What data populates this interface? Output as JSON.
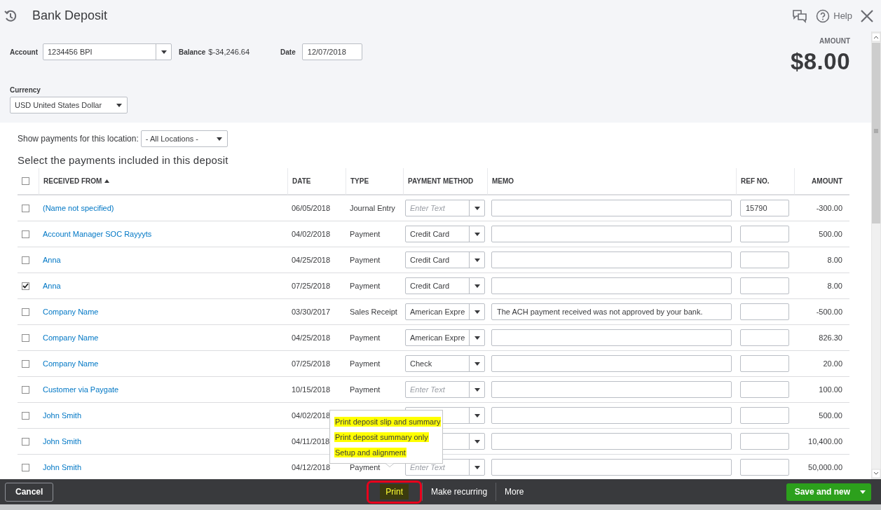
{
  "window": {
    "title": "Bank Deposit",
    "help": "Help"
  },
  "form": {
    "account": {
      "label": "Account",
      "value": "1234456 BPI"
    },
    "balance": {
      "label": "Balance",
      "value": "$-34,246.64"
    },
    "date": {
      "label": "Date",
      "value": "12/07/2018"
    },
    "currency": {
      "label": "Currency",
      "value": "USD United States Dollar"
    },
    "amount": {
      "label": "AMOUNT",
      "value": "$8.00"
    }
  },
  "location": {
    "label": "Show payments for this location:",
    "value": "- All Locations -"
  },
  "section_title": "Select the payments included in this deposit",
  "table": {
    "select_all": {
      "checked": false
    },
    "columns": [
      "RECEIVED FROM",
      "DATE",
      "TYPE",
      "PAYMENT METHOD",
      "MEMO",
      "REF NO.",
      "AMOUNT"
    ],
    "rows": [
      {
        "checked": false,
        "received_from": "(Name not specified)",
        "date": "06/05/2018",
        "type": "Journal Entry",
        "payment_placeholder": "Enter Text",
        "ref_no": "15790",
        "amount": "-300.00"
      },
      {
        "checked": false,
        "received_from": "Account Manager SOC Rayyyts",
        "date": "04/02/2018",
        "type": "Payment",
        "payment_method": "Credit Card",
        "amount": "500.00"
      },
      {
        "checked": false,
        "received_from": "Anna",
        "date": "04/25/2018",
        "type": "Payment",
        "payment_method": "Credit Card",
        "amount": "8.00"
      },
      {
        "checked": true,
        "received_from": "Anna",
        "date": "07/25/2018",
        "type": "Payment",
        "payment_method": "Credit Card",
        "amount": "8.00"
      },
      {
        "checked": false,
        "received_from": "Company Name",
        "date": "03/30/2017",
        "type": "Sales Receipt",
        "payment_method": "American Expre",
        "memo": "The ACH payment received was not approved by your bank.",
        "amount": "-500.00"
      },
      {
        "checked": false,
        "received_from": "Company Name",
        "date": "04/25/2018",
        "type": "Payment",
        "payment_method": "American Expre",
        "amount": "826.30"
      },
      {
        "checked": false,
        "received_from": "Company Name",
        "date": "07/25/2018",
        "type": "Payment",
        "payment_method": "Check",
        "amount": "20.00"
      },
      {
        "checked": false,
        "received_from": "Customer via Paygate",
        "date": "10/15/2018",
        "type": "Payment",
        "payment_placeholder": "Enter Text",
        "amount": "100.00"
      },
      {
        "checked": false,
        "received_from": "John Smith",
        "date": "04/02/2018",
        "amount": "500.00"
      },
      {
        "checked": false,
        "received_from": "John Smith",
        "date": "04/11/2018",
        "amount": "10,400.00"
      },
      {
        "checked": false,
        "received_from": "John Smith",
        "date": "04/12/2018",
        "type": "Payment",
        "payment_placeholder": "Enter Text",
        "amount": "50,000.00"
      }
    ]
  },
  "print_menu": {
    "items": [
      {
        "label": "Print deposit slip and summary",
        "highlighted": true
      },
      {
        "label": "Print deposit summary only",
        "highlighted": true
      },
      {
        "label": "Setup and alignment",
        "highlighted": true
      }
    ]
  },
  "footer": {
    "cancel": "Cancel",
    "print": {
      "label": "Print",
      "outlined": true
    },
    "make_recurring": "Make recurring",
    "more": "More",
    "save": "Save and new"
  }
}
